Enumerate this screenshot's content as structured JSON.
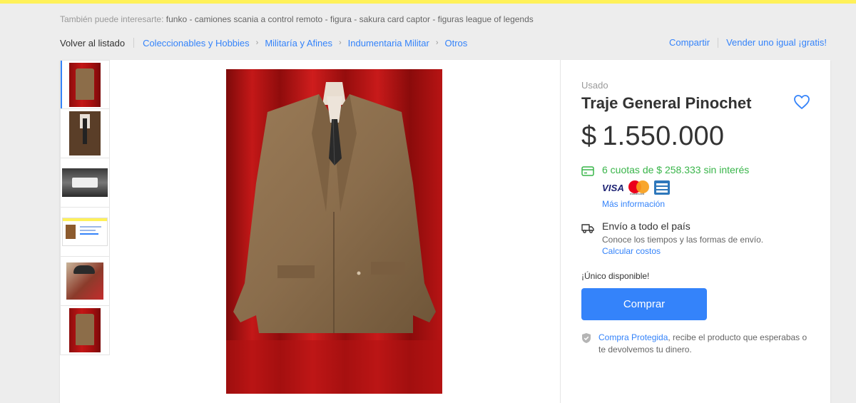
{
  "colors": {
    "accent": "#3483fa",
    "brand_bar": "#fff159",
    "installments": "#39b54a"
  },
  "interests": {
    "lead": "También puede interesarte:",
    "items": [
      "funko",
      "camiones scania a control remoto",
      "figura",
      "sakura card captor",
      "figuras league of legends"
    ],
    "separator": " - "
  },
  "breadcrumb": {
    "back_label": "Volver al listado",
    "items": [
      "Coleccionables y Hobbies",
      "Militaría y Afines",
      "Indumentaria Militar",
      "Otros"
    ]
  },
  "actions": {
    "share": "Compartir",
    "sell": "Vender uno igual ¡gratis!"
  },
  "gallery": {
    "thumbnails": [
      "jacket-on-red-curtain",
      "suit-shirt-tie",
      "clothing-label",
      "listing-screenshot",
      "general-portrait",
      "jacket-on-red-curtain"
    ],
    "active_index": 0,
    "main_image": "jacket-on-red-curtain"
  },
  "product": {
    "condition": "Usado",
    "title": "Traje General Pinochet",
    "currency": "$",
    "price": "1.550.000"
  },
  "payment": {
    "installments": "6 cuotas de $ 258.333 sin interés",
    "cards": [
      "VISA",
      "mastercard",
      "american-express"
    ],
    "visa_label": "VISA",
    "mastercard_label": "mastercard",
    "more_info": "Más información"
  },
  "shipping": {
    "title": "Envío a todo el país",
    "subtitle": "Conoce los tiempos y las formas de envío.",
    "link": "Calcular costos"
  },
  "availability": "¡Único disponible!",
  "buy_button": "Comprar",
  "protection": {
    "link": "Compra Protegida",
    "text": ", recibe el producto que esperabas o te devolvemos tu dinero."
  }
}
